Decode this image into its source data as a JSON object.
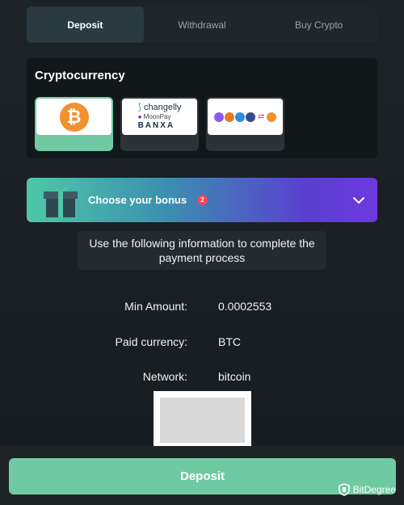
{
  "tabs": [
    {
      "label": "Deposit",
      "active": true
    },
    {
      "label": "Withdrawal",
      "active": false
    },
    {
      "label": "Buy Crypto",
      "active": false
    }
  ],
  "crypto": {
    "title": "Cryptocurrency",
    "cards": [
      {
        "name": "bitcoin",
        "icon": "bitcoin-icon",
        "symbol": "₿",
        "selected": true
      },
      {
        "name": "providers",
        "lines": [
          "changelly",
          "MoonPay",
          "BANXA"
        ],
        "selected": false
      },
      {
        "name": "multi-coin",
        "icon": "multi-coin-icon",
        "selected": false
      }
    ]
  },
  "bonus": {
    "label": "Choose your bonus",
    "badge": "2"
  },
  "info_text": "Use the following information to complete the payment process",
  "details": [
    {
      "label": "Min Amount:",
      "value": "0.0002553"
    },
    {
      "label": "Paid currency:",
      "value": "BTC"
    },
    {
      "label": "Network:",
      "value": "bitcoin"
    }
  ],
  "deposit_button": "Deposit",
  "watermark": "BitDegree",
  "colors": {
    "accent": "#6fcaa4",
    "bitcoin": "#f1922e",
    "badge": "#e84a5f",
    "background": "#1d2327"
  }
}
